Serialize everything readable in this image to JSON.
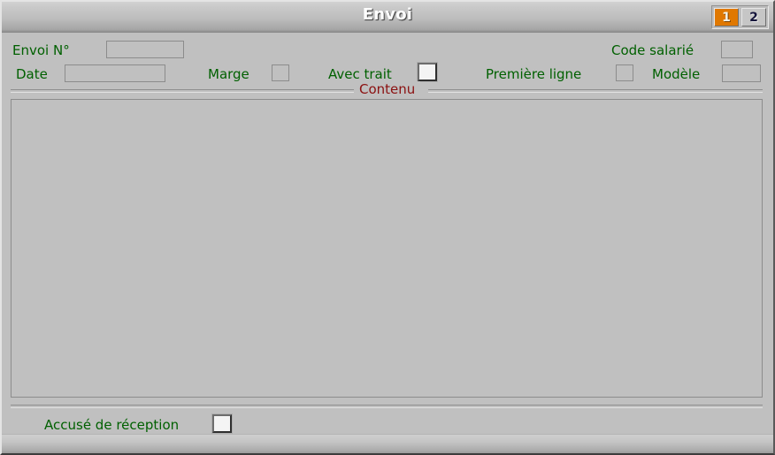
{
  "window": {
    "title": "Envoi"
  },
  "tabs": [
    {
      "label": "1",
      "state": "active"
    },
    {
      "label": "2",
      "state": "inactive"
    }
  ],
  "fields": {
    "envoi_numero": {
      "label": "Envoi N°",
      "value": "",
      "placeholder": ""
    },
    "date": {
      "label": "Date",
      "value": "",
      "placeholder": ""
    },
    "marge": {
      "label": "Marge",
      "checked": false,
      "focused": false
    },
    "avec_trait": {
      "label": "Avec trait",
      "checked": false,
      "focused": true
    },
    "premiere_ligne": {
      "label": "Première ligne",
      "checked": false,
      "focused": false
    },
    "code_salarie": {
      "label": "Code salarié",
      "value": "",
      "placeholder": ""
    },
    "modele": {
      "label": "Modèle",
      "value": "",
      "placeholder": ""
    },
    "accuse_reception": {
      "label": "Accusé de réception",
      "checked": false,
      "focused": true
    }
  },
  "content_group": {
    "title": "Contenu",
    "value": "",
    "placeholder": ""
  },
  "colors": {
    "window_background": "#c0c0c0",
    "label_green": "#006000",
    "group_title_red": "#8b1010",
    "tab_active_orange": "#e07800",
    "tab_active_text": "#f2f2e8",
    "tab_inactive_text": "#16163c",
    "title_text": "#ffffff",
    "field_border": "#8c8c8c",
    "focus_checkbox_fill": "#f4f4f4"
  }
}
